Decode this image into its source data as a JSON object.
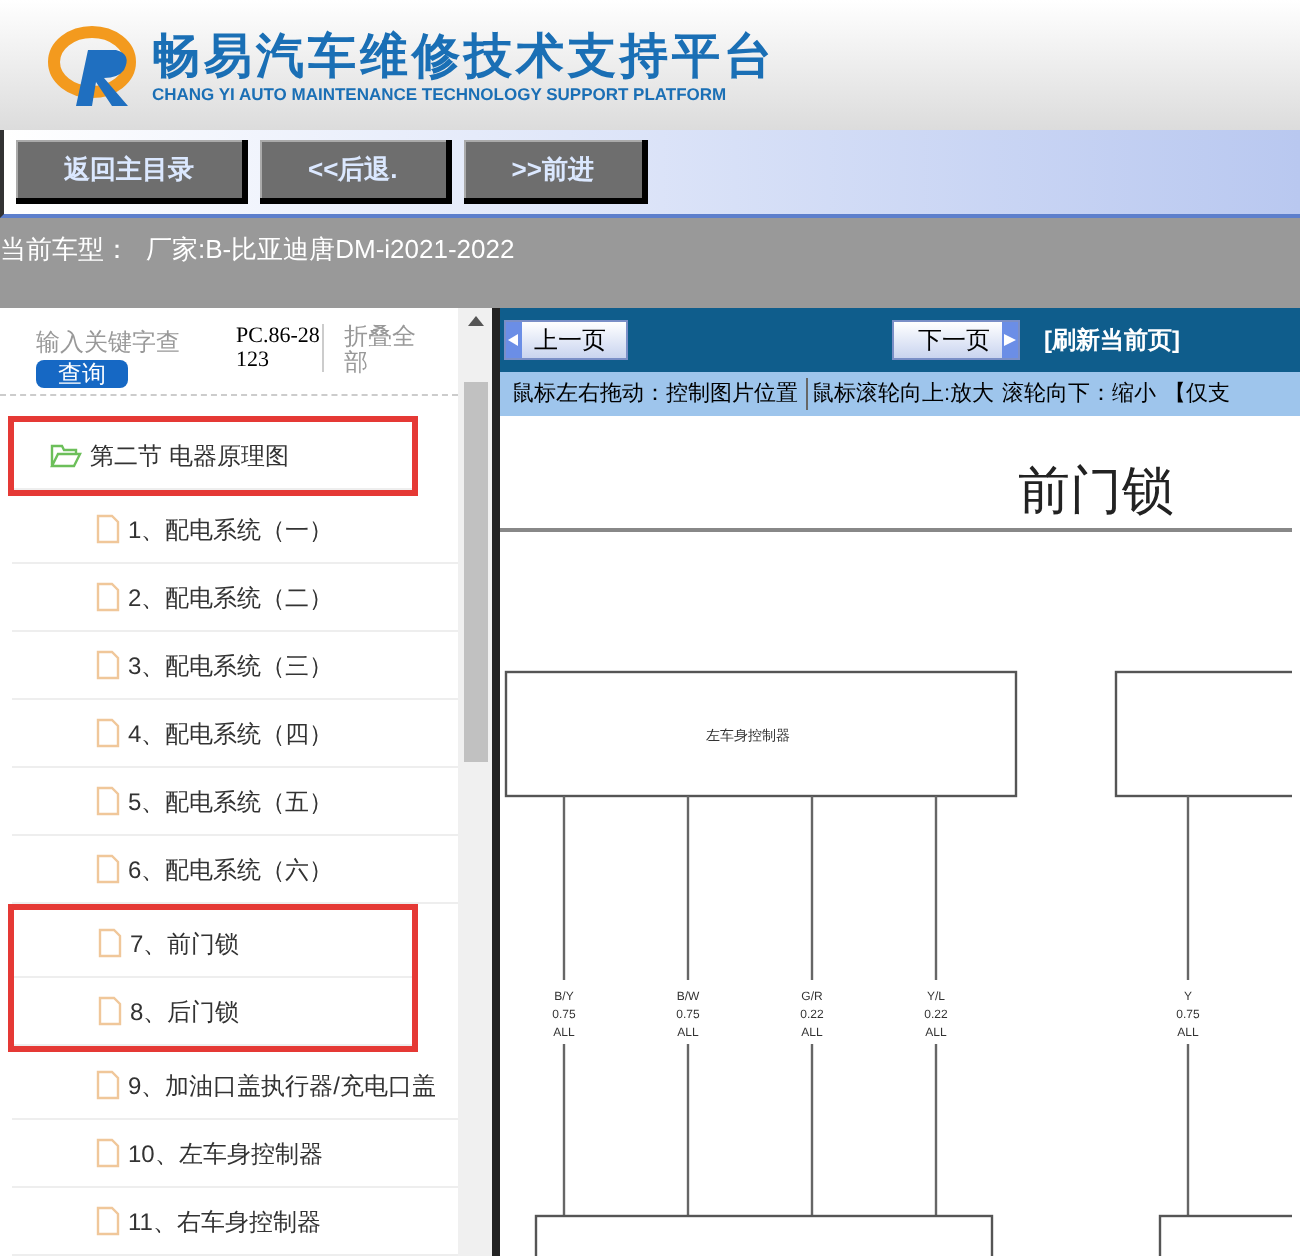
{
  "header": {
    "title": "畅易汽车维修技术支持平台",
    "subtitle": "CHANG YI AUTO MAINTENANCE TECHNOLOGY SUPPORT PLATFORM"
  },
  "toolbar": {
    "buttons": [
      "返回主目录",
      "<<后退.",
      ">>前进"
    ]
  },
  "vehicle": {
    "label": "当前车型：",
    "value": "厂家:B-比亚迪唐DM-i2021-2022"
  },
  "sidebar": {
    "search": {
      "placeholder": "输入关键字查",
      "button": "查询"
    },
    "code": "PC.86-28123",
    "collapse": "折叠全部",
    "items": [
      {
        "kind": "folder",
        "label": "第二节 电器原理图",
        "highlighted": true
      },
      {
        "kind": "file",
        "label": "1、配电系统（一）",
        "highlighted": false
      },
      {
        "kind": "file",
        "label": "2、配电系统（二）",
        "highlighted": false
      },
      {
        "kind": "file",
        "label": "3、配电系统（三）",
        "highlighted": false
      },
      {
        "kind": "file",
        "label": "4、配电系统（四）",
        "highlighted": false
      },
      {
        "kind": "file",
        "label": "5、配电系统（五）",
        "highlighted": false
      },
      {
        "kind": "file",
        "label": "6、配电系统（六）",
        "highlighted": false
      },
      {
        "kind": "file",
        "label": "7、前门锁",
        "highlighted": true
      },
      {
        "kind": "file",
        "label": "8、后门锁",
        "highlighted": true
      },
      {
        "kind": "file",
        "label": "9、加油口盖执行器/充电口盖",
        "highlighted": false
      },
      {
        "kind": "file",
        "label": "10、左车身控制器",
        "highlighted": false
      },
      {
        "kind": "file",
        "label": "11、右车身控制器",
        "highlighted": false
      }
    ]
  },
  "viewer": {
    "prev": "上一页",
    "next": "下一页",
    "refresh": "[刷新当前页]",
    "hints": [
      "鼠标左右拖动：控制图片位置",
      "鼠标滚轮向上:放大",
      "滚轮向下：缩小",
      "【仅支"
    ],
    "diagram": {
      "title": "前门锁",
      "controller": "左车身控制器",
      "wires": [
        {
          "code": "B/Y",
          "gauge": "0.75",
          "option": "ALL"
        },
        {
          "code": "B/W",
          "gauge": "0.75",
          "option": "ALL"
        },
        {
          "code": "G/R",
          "gauge": "0.22",
          "option": "ALL"
        },
        {
          "code": "Y/L",
          "gauge": "0.22",
          "option": "ALL"
        },
        {
          "code": "Y",
          "gauge": "0.75",
          "option": "ALL"
        }
      ]
    }
  }
}
